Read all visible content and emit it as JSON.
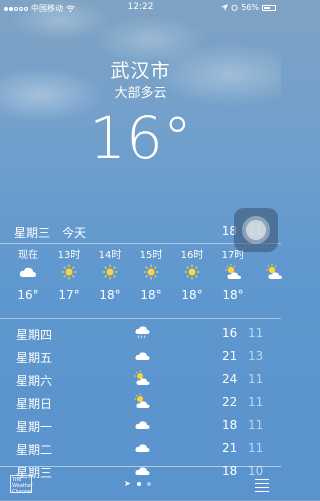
{
  "status": {
    "carrier": "中国移动",
    "time": "12:22",
    "battery": "56%",
    "battery_level": 0.56
  },
  "location": {
    "city": "武汉市",
    "condition": "大部多云",
    "temperature": "16°"
  },
  "today": {
    "day": "星期三",
    "label": "今天",
    "high": "18",
    "low": "11"
  },
  "hourly": [
    {
      "time": "现在",
      "icon": "cloud-icon",
      "temp": "16°"
    },
    {
      "time": "13时",
      "icon": "sun-icon",
      "temp": "17°"
    },
    {
      "time": "14时",
      "icon": "sun-icon",
      "temp": "18°"
    },
    {
      "time": "15时",
      "icon": "sun-icon",
      "temp": "18°"
    },
    {
      "time": "16时",
      "icon": "sun-icon",
      "temp": "18°"
    },
    {
      "time": "17时",
      "icon": "partly-cloudy-icon",
      "temp": "18°"
    },
    {
      "time": "",
      "icon": "partly-cloudy-icon",
      "temp": ""
    }
  ],
  "daily": [
    {
      "day": "星期四",
      "icon": "rain-icon",
      "high": "16",
      "low": "11"
    },
    {
      "day": "星期五",
      "icon": "cloud-icon",
      "high": "21",
      "low": "13"
    },
    {
      "day": "星期六",
      "icon": "partly-cloudy-icon",
      "high": "24",
      "low": "11"
    },
    {
      "day": "星期日",
      "icon": "partly-cloudy-icon",
      "high": "22",
      "low": "11"
    },
    {
      "day": "星期一",
      "icon": "cloud-icon",
      "high": "18",
      "low": "11"
    },
    {
      "day": "星期二",
      "icon": "cloud-icon",
      "high": "21",
      "low": "11"
    },
    {
      "day": "星期三",
      "icon": "cloud-icon",
      "high": "18",
      "low": "10"
    }
  ],
  "footer": {
    "logo_text": "The Weather Channel"
  }
}
